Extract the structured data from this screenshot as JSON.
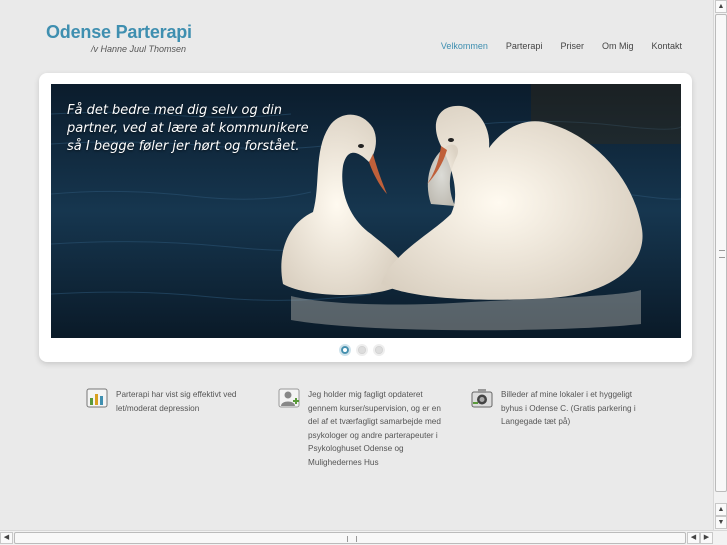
{
  "logo": {
    "title": "Odense Parterapi",
    "subtitle": "/v Hanne Juul Thomsen"
  },
  "nav": {
    "items": [
      {
        "label": "Velkommen",
        "active": true
      },
      {
        "label": "Parterapi"
      },
      {
        "label": "Priser"
      },
      {
        "label": "Om Mig"
      },
      {
        "label": "Kontakt"
      }
    ]
  },
  "slider": {
    "caption": "Få det bedre med dig selv og din partner, ved at lære at kommunikere så I begge føler jer hørt og forstået.",
    "active_slide": 1,
    "slide_count": 3
  },
  "features": [
    {
      "icon": "chart-icon",
      "text": "Parterapi har vist sig effektivt ved let/moderat depression"
    },
    {
      "icon": "user-add-icon",
      "text": "Jeg holder mig fagligt opdateret gennem kurser/supervision, og er en del af et tværfagligt samarbejde med psykologer og andre parterapeuter i Psykologhuset Odense og Mulighedernes Hus"
    },
    {
      "icon": "camera-icon",
      "text": "Billeder af mine lokaler i et hyggeligt byhus i Odense C. (Gratis parkering i Langegade tæt på)"
    }
  ],
  "colors": {
    "accent": "#3f8fb0",
    "background": "#eaeaea"
  }
}
